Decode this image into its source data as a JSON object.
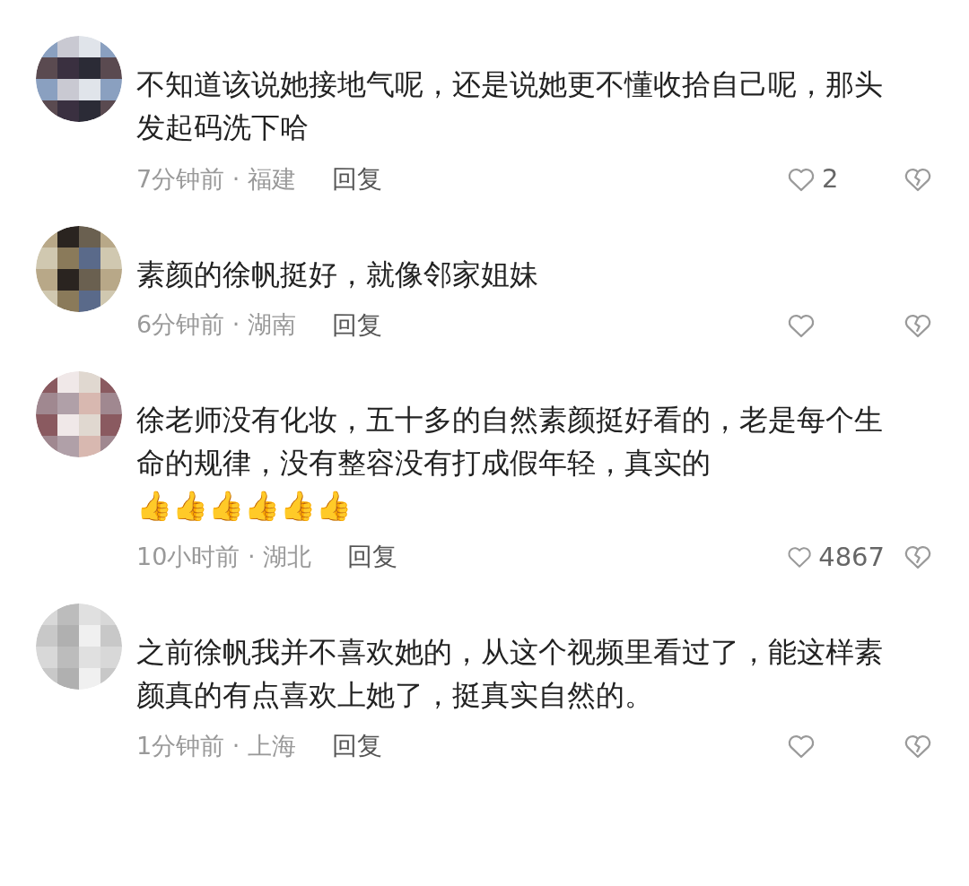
{
  "comments": [
    {
      "text": "不知道该说她接地气呢，还是说她更不懂收拾自己呢，那头发起码洗下哈",
      "time": "7分钟前 · 福建",
      "reply": "回复",
      "likes": "2"
    },
    {
      "text": "素颜的徐帆挺好，就像邻家姐妹",
      "time": "6分钟前 · 湖南",
      "reply": "回复"
    },
    {
      "text": "徐老师没有化妆，五十多的自然素颜挺好看的，老是每个生命的规律，没有整容没有打成假年轻，真实的",
      "emojis": "👍👍👍👍👍👍",
      "time": "10小时前 · 湖北",
      "reply": "回复",
      "likes": "4867"
    },
    {
      "text": "之前徐帆我并不喜欢她的，从这个视频里看过了，能这样素颜真的有点喜欢上她了，挺真实自然的。",
      "time": "1分钟前 · 上海",
      "reply": "回复"
    }
  ]
}
